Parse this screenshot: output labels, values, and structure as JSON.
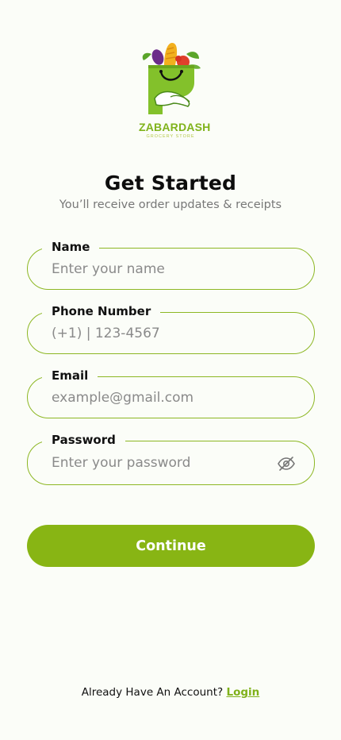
{
  "brand": {
    "name": "ZABARDASH",
    "tagline": "GROCERY STORE",
    "logo_icon": "grocery-bag-logo-icon",
    "accent_color": "#88b514"
  },
  "header": {
    "title": "Get Started",
    "subtitle": "You’ll receive order updates & receipts"
  },
  "form": {
    "name": {
      "label": "Name",
      "placeholder": "Enter your name",
      "value": ""
    },
    "phone": {
      "label": "Phone Number",
      "placeholder": "(+1) | 123-4567",
      "value": ""
    },
    "email": {
      "label": "Email",
      "placeholder": "example@gmail.com",
      "value": ""
    },
    "password": {
      "label": "Password",
      "placeholder": "Enter your password",
      "value": "",
      "toggle_icon": "eye-off-icon"
    }
  },
  "actions": {
    "continue_label": "Continue"
  },
  "footer": {
    "prompt": "Already Have An Account?",
    "login_label": "Login"
  }
}
